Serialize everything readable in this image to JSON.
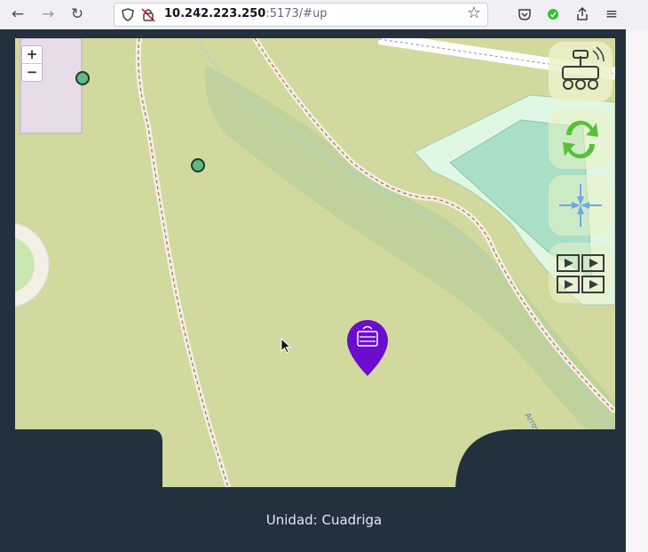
{
  "browser": {
    "url_host": "10.242.223.250",
    "url_rest": ":5173/#up",
    "icons": [
      "back-arrow-icon",
      "forward-arrow-icon",
      "reload-icon",
      "shield-icon",
      "lock-icon",
      "star-icon",
      "pocket-icon",
      "extension-icon",
      "share-icon",
      "menu-icon"
    ]
  },
  "map": {
    "zoom_in_label": "+",
    "zoom_out_label": "−",
    "stream_label": "Arroyo de las Cañadas",
    "colors": {
      "land": "#d2d99e",
      "forest_strip": "#bccf9b",
      "park": "#dff7e3",
      "pond": "#a9dfc4",
      "building": "#e8dcea",
      "waypoint": "#5fba7d",
      "robot_marker": "#6a0dcf"
    }
  },
  "controls": {
    "icons": [
      "rover-icon",
      "sync-icon",
      "center-arrows-icon",
      "video-grid-icon"
    ]
  },
  "footer": {
    "unit_text": "Unidad: Cuadriga"
  }
}
